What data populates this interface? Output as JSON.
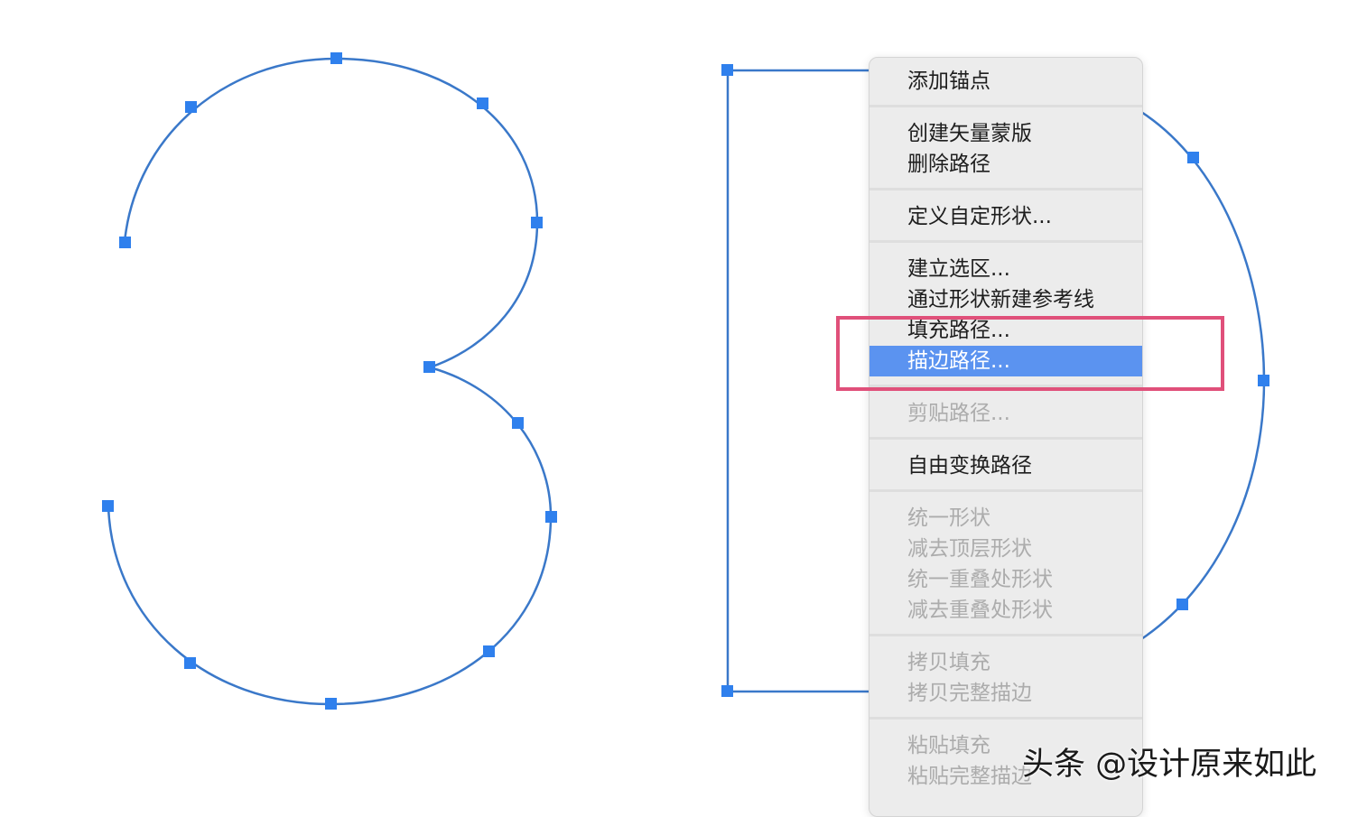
{
  "colors": {
    "path_stroke": "#3a78c9",
    "anchor_fill": "#2f80ed",
    "menu_bg": "#ececec",
    "selected_bg": "#5b93f0",
    "disabled_text": "#acacac",
    "highlight_box": "#e0507a"
  },
  "context_menu": {
    "items": [
      {
        "label": "添加锚点",
        "state": "enabled"
      },
      {
        "label": "创建矢量蒙版",
        "state": "enabled"
      },
      {
        "label": "删除路径",
        "state": "enabled"
      },
      {
        "label": "定义自定形状...",
        "state": "enabled"
      },
      {
        "label": "建立选区...",
        "state": "enabled"
      },
      {
        "label": "通过形状新建参考线",
        "state": "enabled"
      },
      {
        "label": "填充路径...",
        "state": "enabled"
      },
      {
        "label": "描边路径...",
        "state": "selected"
      },
      {
        "label": "剪贴路径...",
        "state": "disabled"
      },
      {
        "label": "自由变换路径",
        "state": "enabled"
      },
      {
        "label": "统一形状",
        "state": "disabled"
      },
      {
        "label": "减去顶层形状",
        "state": "disabled"
      },
      {
        "label": "统一重叠处形状",
        "state": "disabled"
      },
      {
        "label": "减去重叠处形状",
        "state": "disabled"
      },
      {
        "label": "拷贝填充",
        "state": "disabled"
      },
      {
        "label": "拷贝完整描边",
        "state": "disabled"
      },
      {
        "label": "粘贴填充",
        "state": "disabled"
      },
      {
        "label": "粘贴完整描边",
        "state": "disabled"
      }
    ]
  },
  "watermark": "头条 @设计原来如此"
}
